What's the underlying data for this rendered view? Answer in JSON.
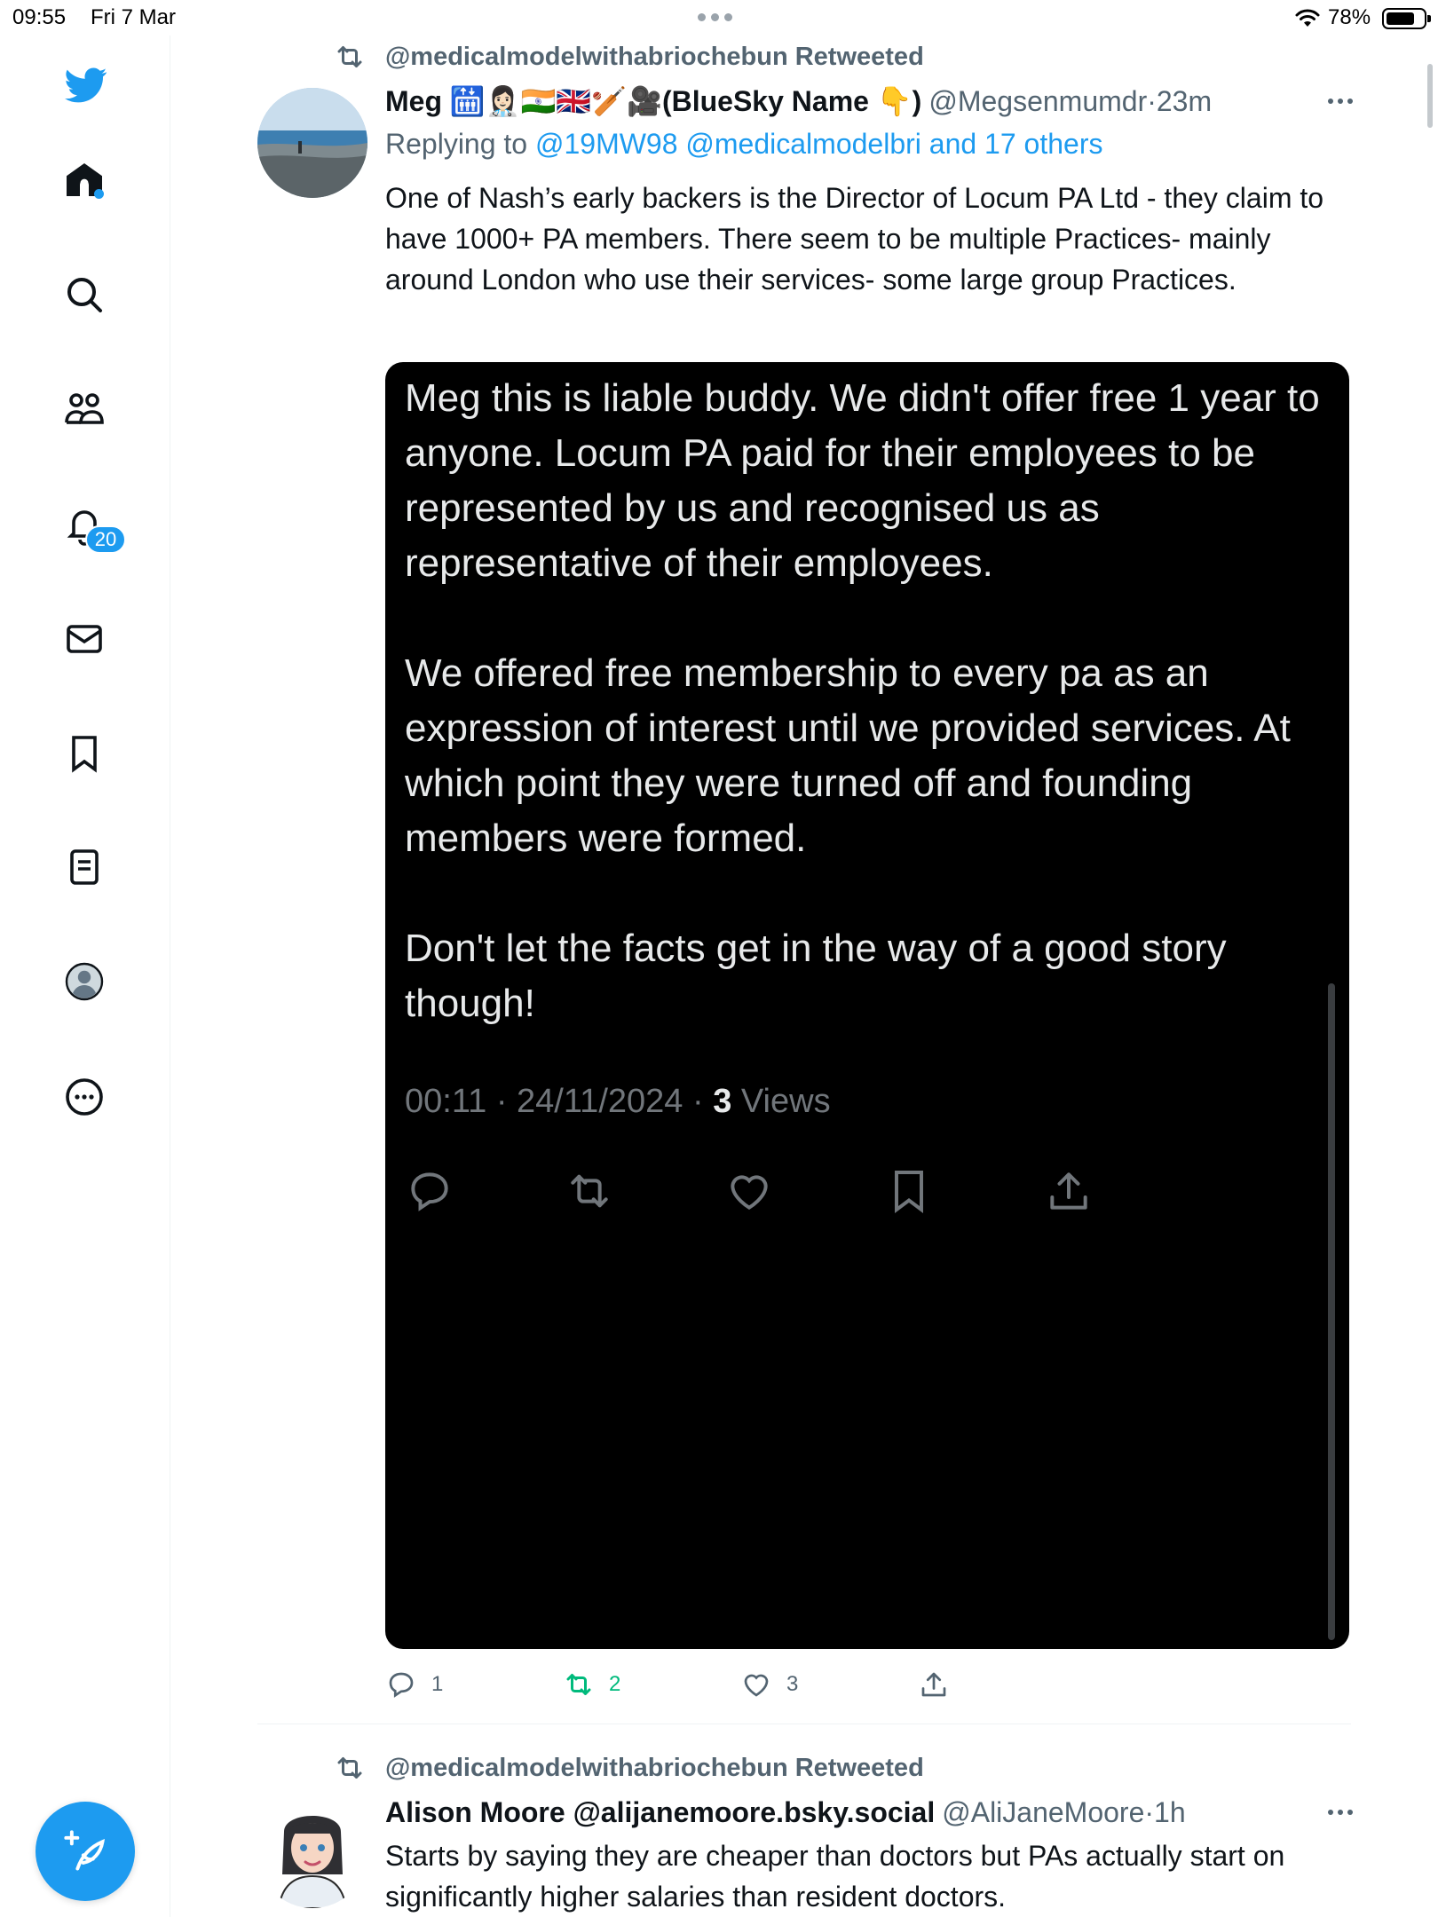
{
  "status_bar": {
    "time": "09:55",
    "date": "Fri 7 Mar",
    "battery_percent": "78%",
    "battery_level": 0.78
  },
  "sidebar": {
    "items": [
      {
        "name": "home",
        "icon": "home-icon"
      },
      {
        "name": "explore",
        "icon": "search-icon"
      },
      {
        "name": "communities",
        "icon": "communities-icon"
      },
      {
        "name": "notifications",
        "icon": "bell-icon",
        "badge": "20"
      },
      {
        "name": "messages",
        "icon": "envelope-icon"
      },
      {
        "name": "bookmarks",
        "icon": "bookmark-icon"
      },
      {
        "name": "lists",
        "icon": "lists-icon"
      },
      {
        "name": "profile",
        "icon": "profile-avatar-icon"
      },
      {
        "name": "more",
        "icon": "more-circle-icon"
      }
    ],
    "compose_icon": "feather-plus-icon"
  },
  "colors": {
    "accent": "#1d9bf0",
    "retweet_green": "#00ba7c",
    "secondary_text": "#536471"
  },
  "tweets": [
    {
      "retweeted_by": "@medicalmodelwithabriochebun Retweeted",
      "display_name": "Meg 🛗👩🏻‍⚕️🇮🇳🇬🇧🏏🎥(BlueSky Name 👇)",
      "handle": "@Megsenmumdr",
      "separator": "·",
      "time": "23m",
      "replying_prefix": "Replying to",
      "replying_links": "@19MW98 @medicalmodelbri and 17 others",
      "text": "One of Nash’s early backers is the Director of Locum PA Ltd - they claim to have 1000+ PA members. There seem to be multiple Practices- mainly around London who use their services- some large group Practices.",
      "media": {
        "text": "Meg this is liable buddy. We didn't offer free 1 year to anyone. Locum PA paid for their employees to be represented by us and recognised us as representative of their employees.\n\nWe offered free membership to every pa as an expression of interest until we provided services. At which point they were turned off and founding members were formed.\n\nDon't let the facts get in the way of a good story though!",
        "timestamp": "00:11 · 24/11/2024 · ",
        "views_count": "3",
        "views_label": " Views"
      },
      "replies": "1",
      "retweets": "2",
      "likes": "3"
    },
    {
      "retweeted_by": "@medicalmodelwithabriochebun Retweeted",
      "display_name": "Alison Moore @alijanemoore.bsky.social",
      "handle": "@AliJaneMoore",
      "separator": "·",
      "time": "1h",
      "text": "Starts by saying they are cheaper than doctors but PAs actually start on significantly higher salaries than resident doctors."
    }
  ]
}
